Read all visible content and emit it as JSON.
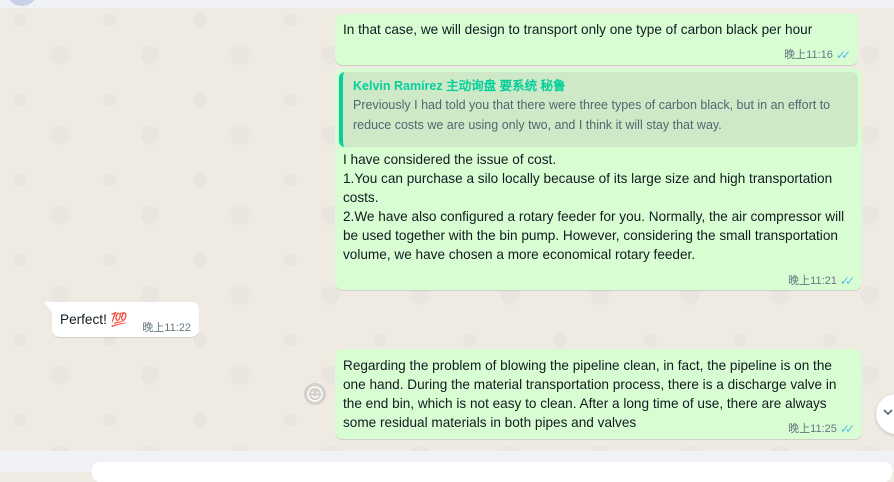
{
  "conversation": {
    "messages": [
      {
        "direction": "outgoing",
        "text": "In that case, we will design to transport only one type of carbon black per hour",
        "time": "晚上11:16",
        "status": "read"
      },
      {
        "direction": "outgoing",
        "quote": {
          "author": "Kelvin Ramírez 主动询盘 要系统 秘鲁",
          "text": "Previously I had told you that there were three types of carbon black, but in an effort to reduce costs we are using only two, and I think it will stay that way."
        },
        "text": "I have considered the issue of cost.\n1.You can purchase a silo locally because of its large size and high transportation costs.\n2.We have also configured a rotary feeder for you. Normally, the air compressor will be used together with the bin pump. However, considering the small transportation volume, we have chosen a more economical rotary feeder.",
        "time": "晚上11:21",
        "status": "read"
      },
      {
        "direction": "incoming",
        "text": "Perfect! 💯",
        "time": "晚上11:22"
      },
      {
        "direction": "outgoing",
        "text": "Regarding the problem of blowing the pipeline clean, in fact, the pipeline is on the one hand. During the material transportation process, there is a discharge valve in the end bin, which is not easy to clean. After a long time of use, there are always some residual materials in both pipes and valves",
        "time": "晚上11:25",
        "status": "read"
      }
    ]
  },
  "icons": {
    "read_ticks": "double-check-icon",
    "reaction": "smiley-icon",
    "scroll_down": "chevron-down-icon"
  },
  "colors": {
    "outgoing_bubble": "#d9fdd3",
    "incoming_bubble": "#ffffff",
    "quote_accent": "#06cf9c",
    "read_ticks": "#53bdeb",
    "chat_background": "#efeae2"
  }
}
